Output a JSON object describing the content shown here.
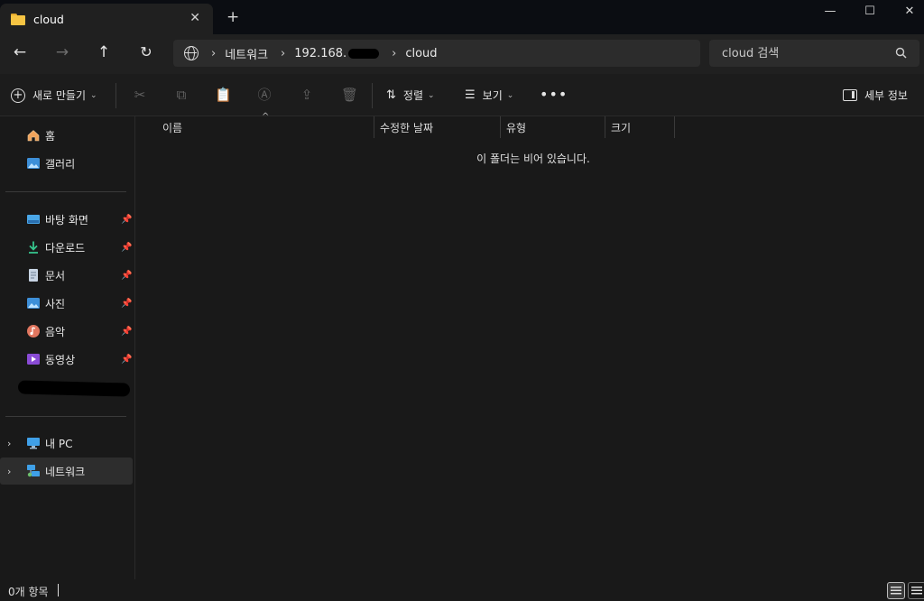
{
  "window": {
    "tab_title": "cloud",
    "close_glyph": "✕",
    "new_tab_glyph": "+",
    "minimize_glyph": "—",
    "maximize_glyph": "☐",
    "close_window_glyph": "✕"
  },
  "nav": {
    "back_glyph": "←",
    "forward_glyph": "→",
    "up_glyph": "↑",
    "refresh_glyph": "↻"
  },
  "breadcrumb": {
    "items": [
      "네트워크",
      "192.168.",
      "cloud"
    ],
    "separator": "›"
  },
  "search": {
    "placeholder": "cloud 검색"
  },
  "toolbar": {
    "new_label": "새로 만들기",
    "sort_label": "정렬",
    "view_label": "보기",
    "more_label": "•••",
    "details_label": "세부 정보",
    "cut_glyph": "✂",
    "copy_glyph": "⧉",
    "paste_glyph": "📋",
    "rename_glyph": "Ⓐ",
    "share_glyph": "⇪",
    "delete_glyph": "🗑",
    "chevron": "⌄"
  },
  "sidebar": {
    "quick": [
      {
        "label": "홈",
        "icon": "home-icon"
      },
      {
        "label": "갤러리",
        "icon": "gallery-icon"
      }
    ],
    "pinned": [
      {
        "label": "바탕 화면",
        "icon": "desktop-icon"
      },
      {
        "label": "다운로드",
        "icon": "download-icon"
      },
      {
        "label": "문서",
        "icon": "document-icon"
      },
      {
        "label": "사진",
        "icon": "pictures-icon"
      },
      {
        "label": "음악",
        "icon": "music-icon"
      },
      {
        "label": "동영상",
        "icon": "videos-icon"
      }
    ],
    "pin_glyph": "📌",
    "expand_glyph": "›",
    "locations": [
      {
        "label": "내 PC",
        "icon": "pc-icon"
      },
      {
        "label": "네트워크",
        "icon": "network-icon",
        "selected": true
      }
    ]
  },
  "columns": [
    "이름",
    "수정한 날짜",
    "유형",
    "크기"
  ],
  "sort_caret": "^",
  "empty_message": "이 폴더는 비어 있습니다.",
  "status": {
    "item_count": "0개 항목"
  },
  "colors": {
    "accent_folder": "#f6c443",
    "background": "#191919",
    "toolbar": "#202020"
  }
}
